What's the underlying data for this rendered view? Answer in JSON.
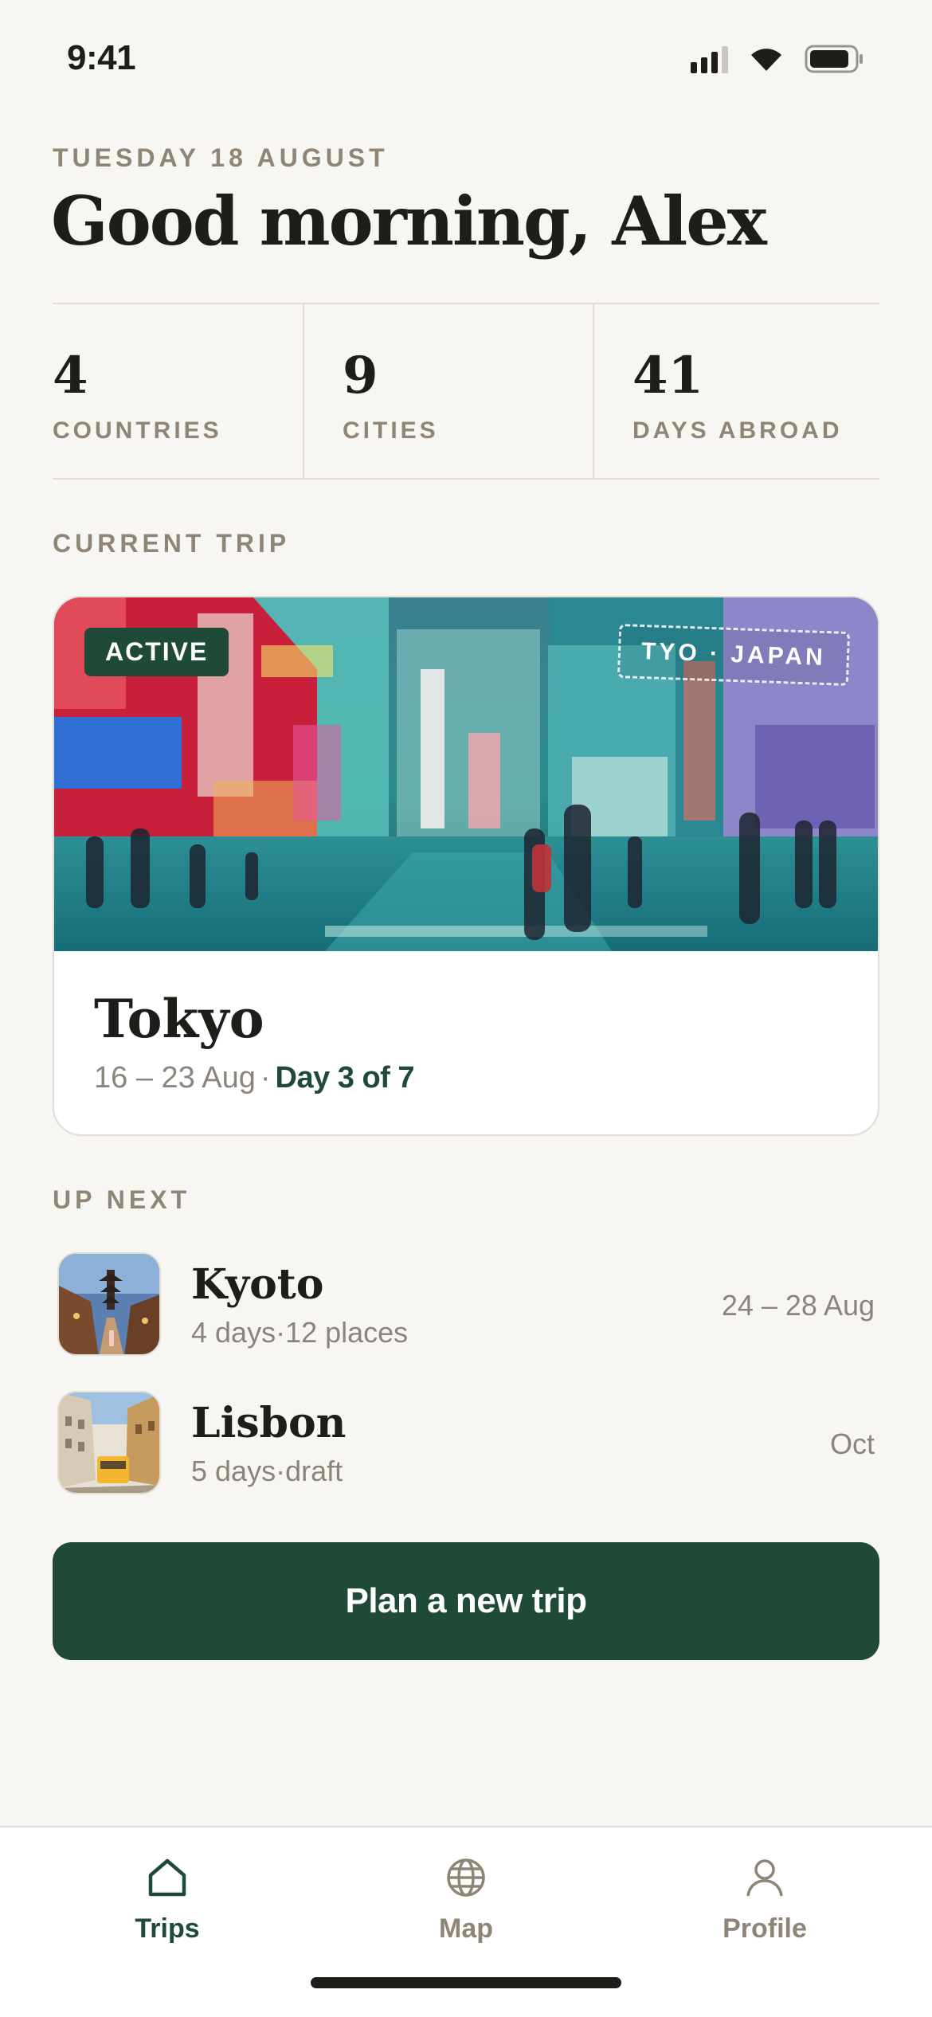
{
  "status_bar": {
    "time": "9:41",
    "icons": [
      "signal-icon",
      "wifi-icon",
      "battery-icon"
    ]
  },
  "header": {
    "date": "TUESDAY 18 AUGUST",
    "greeting": "Good morning, Alex"
  },
  "stats": [
    {
      "value": "4",
      "label": "COUNTRIES"
    },
    {
      "value": "9",
      "label": "CITIES"
    },
    {
      "value": "41",
      "label": "DAYS ABROAD"
    }
  ],
  "current_trip": {
    "section_label": "CURRENT TRIP",
    "status_badge": "ACTIVE",
    "location_stamp": "TYO · JAPAN",
    "city": "Tokyo",
    "dates": "16 – 23 Aug",
    "separator": "·",
    "progress": "Day 3 of 7",
    "photo": "tokyo-street-photo"
  },
  "up_next": {
    "section_label": "UP NEXT",
    "items": [
      {
        "name": "Kyoto",
        "duration": "4 days",
        "separator": "·",
        "detail": "12 places",
        "date": "24 – 28 Aug",
        "thumbnail": "kyoto-pagoda-photo"
      },
      {
        "name": "Lisbon",
        "duration": "5 days",
        "separator": "·",
        "detail": "draft",
        "date": "Oct",
        "thumbnail": "lisbon-tram-photo"
      }
    ]
  },
  "cta": {
    "label": "Plan a new trip"
  },
  "tab_bar": {
    "tabs": [
      {
        "label": "Trips",
        "icon": "home-icon",
        "active": true
      },
      {
        "label": "Map",
        "icon": "globe-icon",
        "active": false
      },
      {
        "label": "Profile",
        "icon": "person-icon",
        "active": false
      }
    ]
  },
  "colors": {
    "background": "#f8f6f2",
    "accent": "#1f4a38",
    "muted": "#8e8577",
    "text": "#1e1d1a",
    "divider": "#e2ddd5"
  }
}
